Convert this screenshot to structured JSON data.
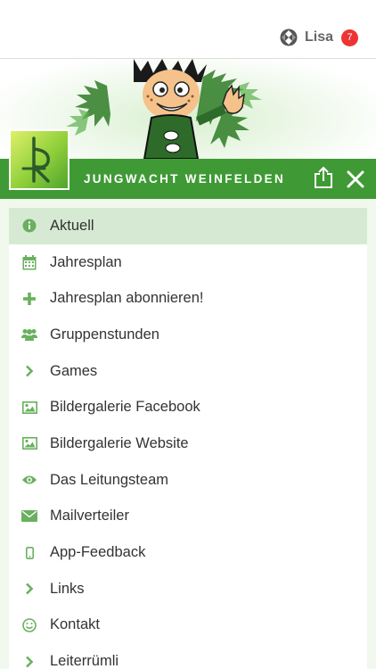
{
  "topbar": {
    "user_name": "Lisa",
    "notification_count": "7"
  },
  "header": {
    "title": "JUNGWACHT WEINFELDEN"
  },
  "menu": {
    "items": [
      {
        "label": "Aktuell",
        "icon": "info-icon",
        "active": true
      },
      {
        "label": "Jahresplan",
        "icon": "calendar-icon",
        "active": false
      },
      {
        "label": "Jahresplan abonnieren!",
        "icon": "plus-icon",
        "active": false
      },
      {
        "label": "Gruppenstunden",
        "icon": "group-icon",
        "active": false
      },
      {
        "label": "Games",
        "icon": "chevron-right-icon",
        "active": false
      },
      {
        "label": "Bildergalerie Facebook",
        "icon": "image-icon",
        "active": false
      },
      {
        "label": "Bildergalerie Website",
        "icon": "image-icon",
        "active": false
      },
      {
        "label": "Das Leitungsteam",
        "icon": "eye-icon",
        "active": false
      },
      {
        "label": "Mailverteiler",
        "icon": "envelope-icon",
        "active": false
      },
      {
        "label": "App-Feedback",
        "icon": "mobile-icon",
        "active": false
      },
      {
        "label": "Links",
        "icon": "chevron-right-icon",
        "active": false
      },
      {
        "label": "Kontakt",
        "icon": "smiley-icon",
        "active": false
      },
      {
        "label": "Leiterrümli",
        "icon": "chevron-right-icon",
        "active": false
      }
    ]
  },
  "colors": {
    "brand_green": "#3f9a35",
    "icon_green": "#6ab05f",
    "active_bg": "#d6ead3",
    "badge_red": "#e33333"
  }
}
